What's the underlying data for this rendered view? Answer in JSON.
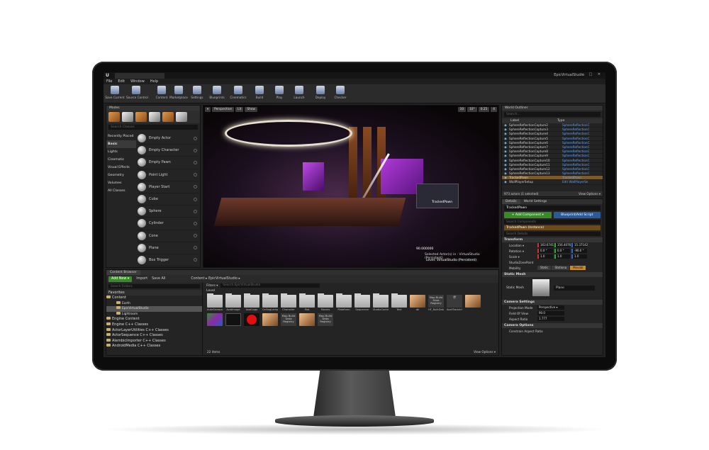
{
  "window": {
    "logo": "U",
    "tab_label": "",
    "project_name": "EpicVirtualStudio",
    "controls": "– □ ✕"
  },
  "menu": [
    "File",
    "Edit",
    "Window",
    "Help"
  ],
  "toolbar": [
    {
      "label": "Save Current",
      "icon": "save-icon"
    },
    {
      "label": "Source Control",
      "icon": "source-control-icon"
    },
    {
      "label": "Content",
      "icon": "content-icon"
    },
    {
      "label": "Marketplace",
      "icon": "marketplace-icon"
    },
    {
      "label": "Settings",
      "icon": "gear-icon"
    },
    {
      "label": "Blueprints",
      "icon": "blueprints-icon"
    },
    {
      "label": "Cinematics",
      "icon": "clapper-icon"
    },
    {
      "label": "Build",
      "icon": "build-icon"
    },
    {
      "label": "Play",
      "icon": "play-icon"
    },
    {
      "label": "Launch",
      "icon": "launch-icon"
    },
    {
      "label": "Deploy",
      "icon": "deploy-icon"
    },
    {
      "label": "Checker",
      "icon": "check-icon"
    }
  ],
  "modes": {
    "tab": "Modes",
    "search_placeholder": "Search Classes",
    "categories": [
      "Recently Placed",
      "Basic",
      "Lights",
      "Cinematic",
      "Visual Effects",
      "Geometry",
      "Volumes",
      "All Classes"
    ],
    "selected_category": 1,
    "items": [
      "Empty Actor",
      "Empty Character",
      "Empty Pawn",
      "Point Light",
      "Player Start",
      "Cube",
      "Sphere",
      "Cylinder",
      "Cone",
      "Plane",
      "Box Trigger"
    ]
  },
  "viewport": {
    "buttons": [
      "▾",
      "Perspective",
      "Lit",
      "Show"
    ],
    "right_controls": [
      "10",
      "10°",
      "0.25",
      "4"
    ],
    "actor_label": "TrackedPawn",
    "value": "90.000000",
    "selected_text": "Selected Actor(s) in : VirtualStudio (Persistent)",
    "level_text": "Level: VirtualStudio (Persistent)"
  },
  "outliner": {
    "tab": "World Outliner",
    "search_placeholder": "Search...",
    "col_label": "Label",
    "col_type": "Type",
    "rows": [
      {
        "name": "SphereReflectionCapture2",
        "type": "SphereReflectionC"
      },
      {
        "name": "SphereReflectionCapture3",
        "type": "SphereReflectionC"
      },
      {
        "name": "SphereReflectionCapture4",
        "type": "SphereReflectionC"
      },
      {
        "name": "SphereReflectionCapture5",
        "type": "SphereReflectionC"
      },
      {
        "name": "SphereReflectionCapture6",
        "type": "SphereReflectionC"
      },
      {
        "name": "SphereReflectionCapture7",
        "type": "SphereReflectionC"
      },
      {
        "name": "SphereReflectionCapture8",
        "type": "SphereReflectionC"
      },
      {
        "name": "SphereReflectionCapture9",
        "type": "SphereReflectionC"
      },
      {
        "name": "SphereReflectionCapture10",
        "type": "SphereReflectionC"
      },
      {
        "name": "SphereReflectionCapture11",
        "type": "SphereReflectionC"
      },
      {
        "name": "SphereReflectionCapture12",
        "type": "SphereReflectionC"
      },
      {
        "name": "SphereReflectionCapture13",
        "type": "SphereReflectionC"
      },
      {
        "name": "TrackedPawn",
        "type": "TrackedPawn"
      },
      {
        "name": "WallPlayerSetup",
        "type": "Edit WallPlayerSe"
      }
    ],
    "highlighted_row": 12,
    "footer": "973 actors (1 selected)",
    "view_options": "View Options ▾"
  },
  "details": {
    "tabs": [
      "Details",
      "World Settings"
    ],
    "actor_name": "TrackedPawn",
    "add_component": "+ Add Component ▾",
    "blueprint": "Blueprint/Add Script",
    "search_components": "Search Components",
    "component": "TrackedPawn (Instance)",
    "search_details": "Search Details",
    "transform_header": "Transform",
    "location": {
      "label": "Location ▾",
      "x": "163.6741",
      "y": "156.4076",
      "z": "15.37142"
    },
    "rotation": {
      "label": "Rotation ▾",
      "x": "0.0 °",
      "y": "0.0 °",
      "z": "-90.0 °"
    },
    "scale": {
      "label": "Scale ▾",
      "x": "1.0",
      "y": "1.0",
      "z": "1.0"
    },
    "studio_pawn": "StudioZonePoint",
    "mobility_label": "Mobility",
    "mobility": [
      "Static",
      "Stationa",
      "Movabl"
    ],
    "mobility_selected": 2,
    "static_mesh_header": "Static Mesh",
    "static_mesh_label": "Static Mesh",
    "static_mesh_value": "Plane",
    "camera_header": "Camera Settings",
    "projection_label": "Projection Mode",
    "projection_value": "Perspective ▾",
    "fov_label": "Field Of View",
    "fov_value": "90.0",
    "aspect_label": "Aspect Ratio",
    "aspect_value": "1.777",
    "camera_options_header": "Camera Options",
    "constrain_label": "Constrain Aspect Ratio"
  },
  "content_browser": {
    "tab": "Content Browser",
    "add_new": "Add New ▾",
    "import": "Import",
    "save_all": "Save All",
    "breadcrumb": [
      "Content",
      "EpicVirtualStudio"
    ],
    "search_folders": "Search Folders",
    "favorites": "Favorites",
    "tree": [
      {
        "label": "Content",
        "sub": false
      },
      {
        "label": "Earth",
        "sub": true
      },
      {
        "label": "EpicVirtualStudio",
        "sub": true,
        "selected": true
      },
      {
        "label": "Lightroom",
        "sub": true
      },
      {
        "label": "Engine Content",
        "sub": false
      },
      {
        "label": "Engine C++ Classes",
        "sub": false
      },
      {
        "label": "ActorLayerUtilities C++ Classes",
        "sub": false
      },
      {
        "label": "ActorSequence C++ Classes",
        "sub": false
      },
      {
        "label": "AlembicImporter C++ Classes",
        "sub": false
      },
      {
        "label": "AndroidMedia C++ Classes",
        "sub": false
      }
    ],
    "filters": "Filters ▾",
    "search_assets": "Search EpicVirtualStudio",
    "level_label": "Level",
    "assets_row1": [
      {
        "label": "AutoSavepage Media",
        "kind": "folder"
      },
      {
        "label": "AvatImage",
        "kind": "folder"
      },
      {
        "label": "AvatLogo",
        "kind": "folder"
      },
      {
        "label": "CeilingLamp",
        "kind": "folder"
      },
      {
        "label": "Character",
        "kind": "folder"
      },
      {
        "label": "Mat",
        "kind": "folder"
      },
      {
        "label": "Movies",
        "kind": "folder"
      },
      {
        "label": "Plateform",
        "kind": "folder"
      },
      {
        "label": "Sequencer",
        "kind": "folder"
      },
      {
        "label": "StudioContents",
        "kind": "folder"
      },
      {
        "label": "Text",
        "kind": "folder"
      },
      {
        "label": "dk",
        "kind": "map"
      },
      {
        "label": "HF_BuiltData",
        "kind": "dark",
        "text": "Map Build Data Registry"
      },
      {
        "label": "AvatTrackerSequencer",
        "kind": "clapper"
      }
    ],
    "assets_row2": [
      {
        "label": "",
        "kind": "map"
      },
      {
        "label": "",
        "kind": "grad"
      },
      {
        "label": "",
        "kind": "curve"
      },
      {
        "label": "",
        "kind": "red"
      },
      {
        "label": "",
        "kind": "map"
      },
      {
        "label": "",
        "kind": "dark",
        "text": "Map Build Data Registry"
      },
      {
        "label": "",
        "kind": "map"
      },
      {
        "label": "",
        "kind": "dark",
        "text": "Map Build Data Registry"
      }
    ],
    "item_count": "22 items",
    "view_options": "View Options ▾"
  }
}
